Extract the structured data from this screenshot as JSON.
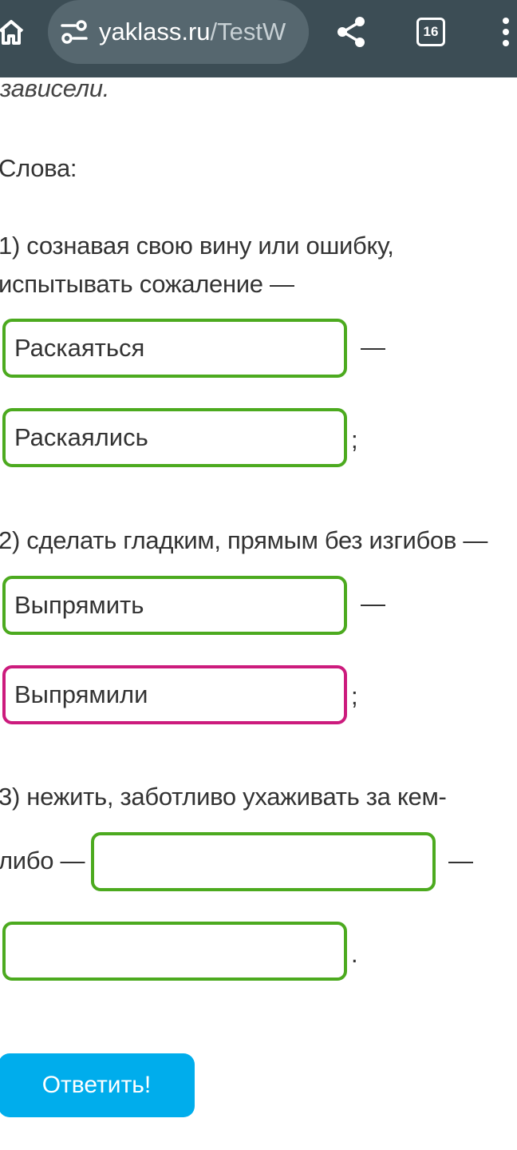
{
  "browser": {
    "url_host": "yaklass.ru",
    "url_path": "/TestW",
    "tab_count": "16",
    "icons": [
      "home-icon",
      "site-info-icon",
      "share-icon",
      "tabs-icon",
      "menu-icon"
    ],
    "colors": {
      "toolbar": "#3c4d55",
      "url_pill": "#56676f"
    }
  },
  "content": {
    "intro_tail": "зависели.",
    "words_label": "Слова:",
    "items": [
      {
        "line1": "1) сознавая свою вину или ошибку,",
        "line2": "испытывать сожаление —",
        "answer1": "Раскаяться",
        "answer2": "Раскаялись",
        "sep1": "—",
        "end": ";"
      },
      {
        "line1": "2) сделать гладким, прямым без изгибов —",
        "answer1": "Выпрямить",
        "answer2": "Выпрямили",
        "sep1": "—",
        "end": ";"
      },
      {
        "line1": "3) нежить, заботливо ухаживать за кем-",
        "line2_prefix": "либо —",
        "answer1": "",
        "answer2": "",
        "sep1": "—",
        "end": "."
      }
    ],
    "colors": {
      "ok_border": "#4caa1f",
      "active_border": "#cc1b7d",
      "submit_bg": "#00adec"
    }
  },
  "submit_label": "Ответить!"
}
